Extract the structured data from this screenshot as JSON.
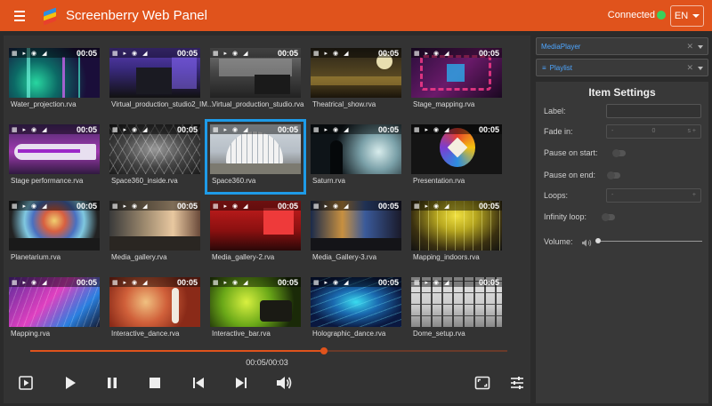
{
  "header": {
    "title": "Screenberry Web Panel",
    "status": "Connected",
    "status_color": "#3ad15b",
    "language": "EN",
    "accent": "#e0531c"
  },
  "tile_icons": "▦ ▸ ◉ ◢",
  "media": [
    {
      "name": "Water_projection.rva",
      "duration": "00:05"
    },
    {
      "name": "Virtual_production_studio2_IM...",
      "duration": "00:05"
    },
    {
      "name": "Virtual_production_studio.rva",
      "duration": "00:05"
    },
    {
      "name": "Theatrical_show.rva",
      "duration": "00:05"
    },
    {
      "name": "Stage_mapping.rva",
      "duration": "00:05"
    },
    {
      "name": "Stage performance.rva",
      "duration": "00:05"
    },
    {
      "name": "Space360_inside.rva",
      "duration": "00:05"
    },
    {
      "name": "Space360.rva",
      "duration": "00:05",
      "selected": true
    },
    {
      "name": "Saturn.rva",
      "duration": "00:05"
    },
    {
      "name": "Presentation.rva",
      "duration": "00:05"
    },
    {
      "name": "Planetarium.rva",
      "duration": "00:05"
    },
    {
      "name": "Media_gallery.rva",
      "duration": "00:05"
    },
    {
      "name": "Media_gallery-2.rva",
      "duration": "00:05"
    },
    {
      "name": "Media_Gallery-3.rva",
      "duration": "00:05"
    },
    {
      "name": "Mapping_indoors.rva",
      "duration": "00:05"
    },
    {
      "name": "Mapping.rva",
      "duration": "00:05"
    },
    {
      "name": "Interactive_dance.rva",
      "duration": "00:05"
    },
    {
      "name": "Interactive_bar.rva",
      "duration": "00:05"
    },
    {
      "name": "Holographic_dance.rva",
      "duration": "00:05"
    },
    {
      "name": "Dome_setup.rva",
      "duration": "00:05"
    }
  ],
  "player": {
    "timecode": "00:05/00:03",
    "progress": 0.615,
    "controls": [
      "playlist-toggle-icon",
      "play-icon",
      "pause-icon",
      "stop-icon",
      "skip-previous-icon",
      "skip-next-icon",
      "volume-icon",
      "fullscreen-icon",
      "settings-sliders-icon"
    ]
  },
  "sidebar": {
    "mediaplayer_select": "MediaPlayer",
    "playlist_select": "Playlist",
    "item_settings": {
      "title": "Item Settings",
      "label_label": "Label:",
      "label_value": "",
      "fade_in_label": "Fade in:",
      "fade_in_minus": "-",
      "fade_in_value": "0",
      "fade_in_unit": "s +",
      "pause_start_label": "Pause on start:",
      "pause_end_label": "Pause on end:",
      "loops_label": "Loops:",
      "loops_minus": "-",
      "loops_plus": "+",
      "infinity_loop_label": "Infinity loop:",
      "volume_label": "Volume:",
      "volume_level": 0.0
    }
  }
}
